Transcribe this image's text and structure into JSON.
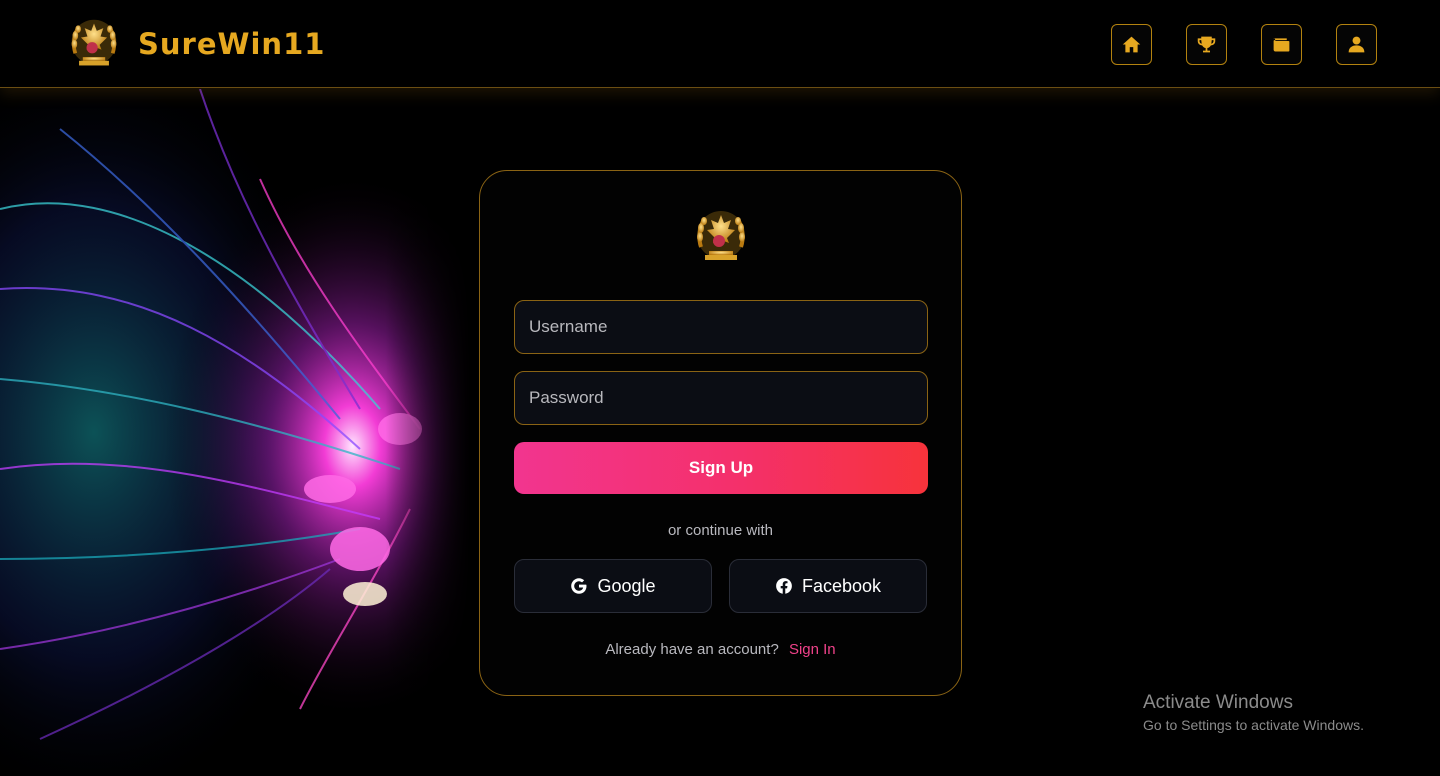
{
  "brand": {
    "name": "SureWin11",
    "logo_icon": "maple-laurel-trophy-icon",
    "accent_color": "#e6a820"
  },
  "nav": [
    {
      "name": "home",
      "icon": "home-icon"
    },
    {
      "name": "trophy",
      "icon": "trophy-icon"
    },
    {
      "name": "wallet",
      "icon": "wallet-icon"
    },
    {
      "name": "profile",
      "icon": "user-icon"
    }
  ],
  "form": {
    "username_placeholder": "Username",
    "password_placeholder": "Password",
    "submit_label": "Sign Up",
    "divider": "or continue with",
    "google_label": "Google",
    "facebook_label": "Facebook",
    "signin_prompt": "Already have an account?",
    "signin_link": "Sign In"
  },
  "colors": {
    "gold": "#e6a820",
    "pink": "#f2358f",
    "red": "#f7333b"
  },
  "watermark": {
    "title": "Activate Windows",
    "subtitle": "Go to Settings to activate Windows."
  }
}
